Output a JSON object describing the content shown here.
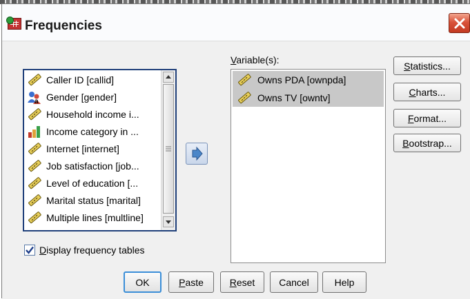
{
  "window": {
    "title": "Frequencies"
  },
  "source_list": {
    "items": [
      {
        "label": "Caller ID [callid]",
        "icon": "ruler-scale-icon"
      },
      {
        "label": "Gender [gender]",
        "icon": "nominal-people-icon"
      },
      {
        "label": "Household income i...",
        "icon": "ruler-scale-icon"
      },
      {
        "label": "Income category in ...",
        "icon": "ordinal-bars-icon"
      },
      {
        "label": "Internet [internet]",
        "icon": "ruler-scale-icon"
      },
      {
        "label": "Job satisfaction [job...",
        "icon": "ruler-scale-icon"
      },
      {
        "label": "Level of education [...",
        "icon": "ruler-scale-icon"
      },
      {
        "label": "Marital status [marital]",
        "icon": "ruler-scale-icon"
      },
      {
        "label": "Multiple lines [multline]",
        "icon": "ruler-scale-icon"
      }
    ]
  },
  "move_button": {
    "icon": "right-arrow-icon"
  },
  "target": {
    "label_prefix": "",
    "label_underlined": "V",
    "label_rest": "ariable(s):",
    "items": [
      {
        "label": "Owns PDA [ownpda]",
        "icon": "ruler-scale-icon"
      },
      {
        "label": "Owns TV [owntv]",
        "icon": "ruler-scale-icon"
      }
    ]
  },
  "side_buttons": {
    "statistics": {
      "u": "S",
      "rest": "tatistics..."
    },
    "charts": {
      "pre": "",
      "u": "C",
      "rest": "harts..."
    },
    "format": {
      "u": "F",
      "rest": "ormat..."
    },
    "bootstrap": {
      "u": "B",
      "rest": "ootstrap..."
    }
  },
  "display_freq": {
    "checked": true,
    "u": "D",
    "rest": "isplay frequency tables"
  },
  "bottom_buttons": {
    "ok": "OK",
    "paste_u": "P",
    "paste_rest": "aste",
    "reset_u": "R",
    "reset_rest": "eset",
    "cancel": "Cancel",
    "help": "Help"
  },
  "colors": {
    "close_button": "#d9523a",
    "selection": "#c8c8c8",
    "focus_border": "#1f3f7a",
    "default_button_border": "#3a8ed8"
  }
}
